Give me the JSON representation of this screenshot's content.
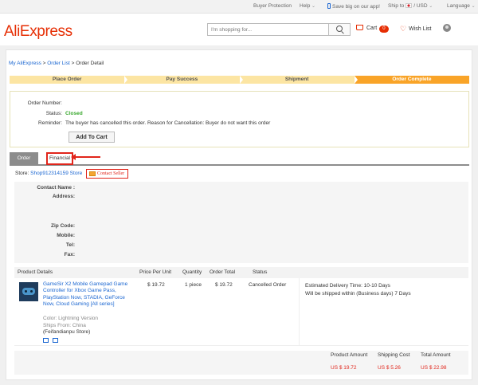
{
  "topbar": {
    "buyer_protection": "Buyer Protection",
    "help": "Help",
    "app_promo": "Save big on our app!",
    "ship_to": "Ship to",
    "currency": "/ USD",
    "language": "Language"
  },
  "header": {
    "logo": "AliExpress",
    "search_placeholder": "I'm shopping for...",
    "cart_label": "Cart",
    "cart_count": "0",
    "wish_list": "Wish List"
  },
  "breadcrumb": {
    "my_aliexpress": "My AliExpress",
    "sep1": " > ",
    "order_list": "Order List",
    "sep2": " > ",
    "current": "Order Detail"
  },
  "progress": [
    "Place Order",
    "Pay Success",
    "Shipment",
    "Order Complete"
  ],
  "order_status": {
    "order_number_label": "Order Number:",
    "order_number": "",
    "status_label": "Status:",
    "status": "Closed",
    "reminder_label": "Reminder:",
    "reminder": "The buyer has cancelled this order. Reason for Cancellation: Buyer do not want this order",
    "add_to_cart": "Add To Cart"
  },
  "tabs": {
    "order": "Order",
    "financial": "Financial"
  },
  "store": {
    "label": "Store:",
    "name": "Shop912314159 Store",
    "contact_seller": "Contact Seller"
  },
  "contact_fields": [
    "Contact Name :",
    "Address:",
    "Zip Code:",
    "Mobile:",
    "Tel:",
    "Fax:"
  ],
  "table": {
    "headers": [
      "Product Details",
      "Price Per Unit",
      "Quantity",
      "Order Total",
      "Status"
    ],
    "item": {
      "title": "GameSir X2 Mobile Gamepad Game Controller for Xbox Game Pass, PlayStation Now, STADIA, GeForce Now, Cloud Gaming [All series]",
      "color": "Color: Lightning Version",
      "ships_from": "Ships From: China",
      "store": "(Feifandianpu Store)",
      "price": "$ 19.72",
      "quantity": "1 piece",
      "total": "$ 19.72",
      "status": "Cancelled Order",
      "delivery_time": "Estimated Delivery Time: 10-10 Days",
      "ship_within": "Will be shipped within (Business days) 7 Days"
    }
  },
  "totals": {
    "product_amount_label": "Product Amount",
    "product_amount": "US $ 19.72",
    "shipping_cost_label": "Shipping Cost",
    "shipping_cost": "US $ 5.26",
    "total_amount_label": "Total Amount",
    "total_amount": "US $ 22.98"
  },
  "colors": {
    "brand": "#e62e04",
    "link": "#1a66d1",
    "step_active": "#f9a428",
    "step_inactive": "#fce5a3",
    "status_closed": "#39a82e",
    "highlight": "#e1251b"
  }
}
